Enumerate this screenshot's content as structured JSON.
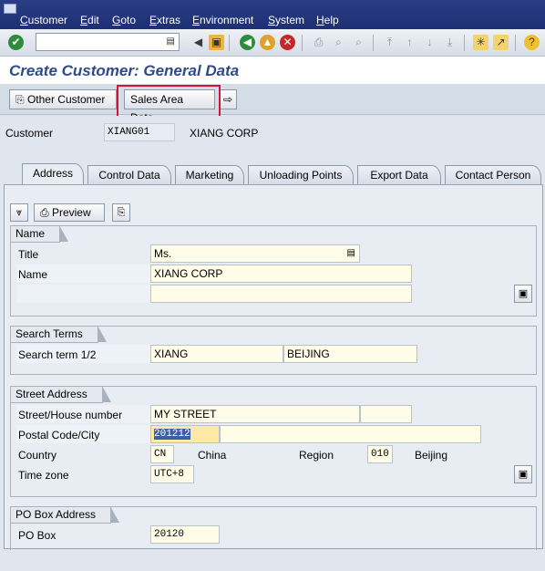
{
  "menu": [
    "Customer",
    "Edit",
    "Goto",
    "Extras",
    "Environment",
    "System",
    "Help"
  ],
  "toolbar": {
    "icons": [
      "enter-icon",
      "save-icon",
      "back-icon",
      "exit-icon",
      "cancel-icon",
      "print-icon",
      "find-icon",
      "find-next-icon",
      "first-page-icon",
      "previous-page-icon",
      "next-page-icon",
      "last-page-icon",
      "new-session-icon",
      "shortcut-icon",
      "help-icon"
    ]
  },
  "title": "Create Customer: General Data",
  "app_toolbar": {
    "other_customer": "Other Customer",
    "sales_area_data": "Sales Area Data"
  },
  "header": {
    "customer_label": "Customer",
    "customer_id": "XIANG01",
    "customer_name": "XIANG CORP"
  },
  "tabs": [
    "Address",
    "Control Data",
    "Marketing",
    "Unloading Points",
    "Export Data",
    "Contact Person"
  ],
  "active_tab": "Address",
  "preview_label": "Preview",
  "name_group": {
    "title": "Name",
    "title_label": "Title",
    "title_value": "Ms.",
    "name_label": "Name",
    "name_value": "XIANG CORP",
    "name2_value": ""
  },
  "search_group": {
    "title": "Search Terms",
    "label": "Search term 1/2",
    "term1": "XIANG",
    "term2": "BEIJING"
  },
  "street_group": {
    "title": "Street Address",
    "street_label": "Street/House number",
    "street_value": "MY STREET",
    "house_value": "",
    "postal_label": "Postal Code/City",
    "postal_value": "201212",
    "city_value": "",
    "country_label": "Country",
    "country_code": "CN",
    "country_name": "China",
    "region_label": "Region",
    "region_code": "010",
    "region_name": "Beijing",
    "tz_label": "Time zone",
    "tz_value": "UTC+8"
  },
  "pobox_group": {
    "title": "PO Box Address",
    "label": "PO Box",
    "value": "20120"
  }
}
